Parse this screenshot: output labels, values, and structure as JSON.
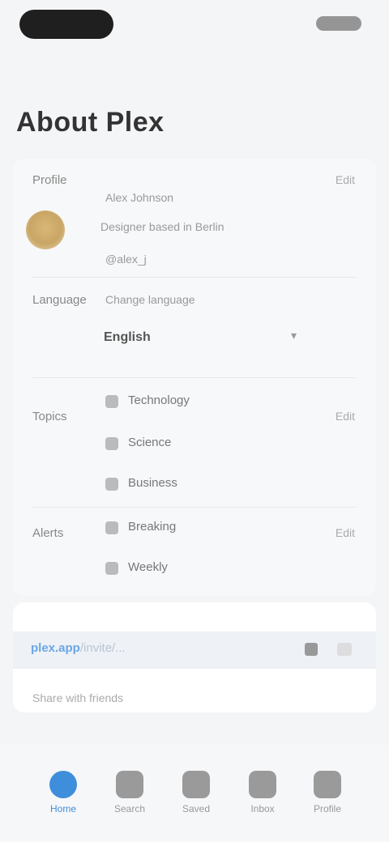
{
  "status_bar": {
    "notch_label": "",
    "status": ""
  },
  "page": {
    "title": "About Plex"
  },
  "profile": {
    "label": "Profile",
    "name": "Alex Johnson",
    "bio": "Designer based in Berlin",
    "handle": "@alex_j",
    "edit": "Edit"
  },
  "language": {
    "label": "Language",
    "selected": "English",
    "link": "Change language"
  },
  "topics": {
    "label": "Topics",
    "edit": "Edit",
    "items": [
      "Technology",
      "Science",
      "Business"
    ]
  },
  "alerts": {
    "label": "Alerts",
    "edit": "Edit",
    "items": [
      "Breaking",
      "Weekly"
    ]
  },
  "invite": {
    "link_bold": "plex.app",
    "link_rest": "/invite/...",
    "hint": "Share with friends"
  },
  "tabs": [
    {
      "label": "Home"
    },
    {
      "label": "Search"
    },
    {
      "label": "Saved"
    },
    {
      "label": "Inbox"
    },
    {
      "label": "Profile"
    }
  ],
  "colors": {
    "accent": "#3f8edb",
    "link": "#6ba7e5"
  }
}
